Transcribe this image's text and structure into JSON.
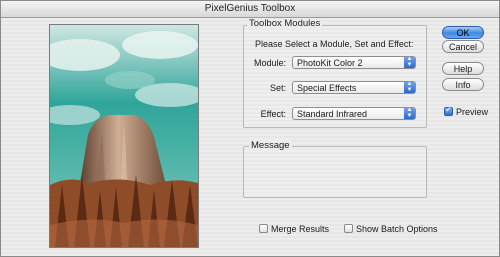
{
  "window": {
    "title": "PixelGenius Toolbox"
  },
  "modules": {
    "group_title": "Toolbox Modules",
    "instruction": "Please Select a Module, Set and Effect:",
    "module_label": "Module:",
    "module_value": "PhotoKit Color 2",
    "set_label": "Set:",
    "set_value": "Special Effects",
    "effect_label": "Effect:",
    "effect_value": "Standard Infrared"
  },
  "message": {
    "title": "Message",
    "text": ""
  },
  "buttons": {
    "ok": "OK",
    "cancel": "Cancel",
    "help": "Help",
    "info": "Info"
  },
  "options": {
    "preview_label": "Preview",
    "preview_checked": true,
    "merge_label": "Merge Results",
    "merge_checked": false,
    "batch_label": "Show Batch Options",
    "batch_checked": false
  },
  "colors": {
    "sky": "#2fa59a",
    "tower": "#b58a6f",
    "trees": "#7a3e1f",
    "accent": "#3f86e2"
  }
}
